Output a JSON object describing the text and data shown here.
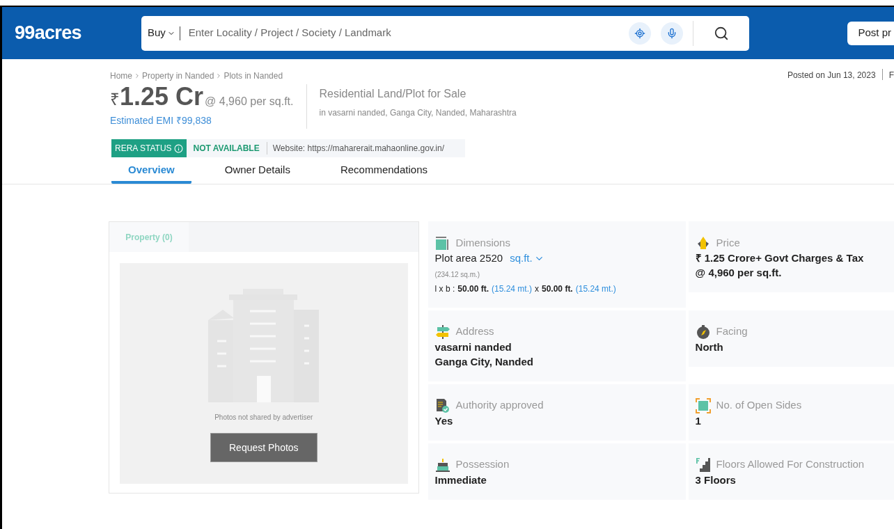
{
  "header": {
    "logo": "99acres",
    "search": {
      "dropdown": "Buy",
      "placeholder": "Enter Locality / Project / Society / Landmark"
    },
    "post_button": "Post pr"
  },
  "breadcrumb": [
    "Home",
    "Property in Nanded",
    "Plots in Nanded"
  ],
  "posted": "Posted on Jun 13, 2023",
  "posted_next": "F",
  "price": {
    "symbol": "₹",
    "amount": "1.25 Cr",
    "rate": "@ 4,960 per sq.ft.",
    "emi": "Estimated EMI ₹99,838"
  },
  "listing": {
    "title": "Residential Land/Plot for Sale",
    "location": "in vasarni nanded, Ganga City, Nanded, Maharashtra"
  },
  "rera": {
    "label": "RERA STATUS",
    "status": "NOT AVAILABLE",
    "website": "Website: https://maharerait.mahaonline.gov.in/"
  },
  "tabs": [
    {
      "label": "Overview",
      "selected": true
    },
    {
      "label": "Owner Details",
      "selected": false
    },
    {
      "label": "Recommendations",
      "selected": false
    }
  ],
  "gallery": {
    "tab": "Property (0)",
    "note": "Photos not shared by advertiser",
    "button": "Request Photos"
  },
  "details": [
    {
      "kind": "dimensions",
      "label": "Dimensions",
      "value": "Plot area 2520",
      "unit": "sq.ft.",
      "sub": "(234.12 sq.m.)",
      "dims": [
        {
          "kind": "plain",
          "text": "l x b :"
        },
        {
          "kind": "bold",
          "text": "50.00 ft."
        },
        {
          "kind": "metric",
          "text": "(15.24 mt.)"
        },
        {
          "kind": "plain",
          "text": "x"
        },
        {
          "kind": "bold",
          "text": "50.00 ft."
        },
        {
          "kind": "metric",
          "text": "(15.24 mt.)"
        }
      ]
    },
    {
      "kind": "price",
      "label": "Price",
      "lines": [
        "₹ 1.25 Crore+ Govt Charges & Tax",
        "@ 4,960 per sq.ft."
      ]
    },
    {
      "kind": "address",
      "label": "Address",
      "lines": [
        "vasarni nanded",
        "Ganga City, Nanded"
      ]
    },
    {
      "kind": "facing",
      "label": "Facing",
      "lines": [
        "North"
      ]
    },
    {
      "kind": "authority",
      "label": "Authority approved",
      "lines": [
        "Yes"
      ]
    },
    {
      "kind": "sides",
      "label": "No. of Open Sides",
      "lines": [
        "1"
      ]
    },
    {
      "kind": "possession",
      "label": "Possession",
      "lines": [
        "Immediate"
      ]
    },
    {
      "kind": "floors",
      "label": "Floors Allowed For Construction",
      "lines": [
        "3 Floors"
      ]
    }
  ]
}
